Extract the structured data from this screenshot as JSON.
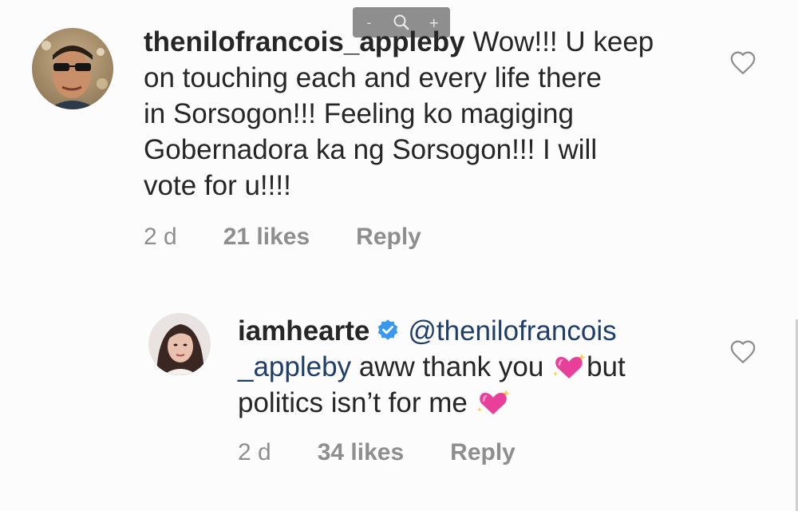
{
  "zoom_controls": {
    "zoom_out": "-",
    "zoom_in": "+"
  },
  "comments": [
    {
      "username": "thenilofrancois_appleby",
      "text_lines": [
        "Wow!!! U keep",
        "on touching each and every life there",
        "in Sorsogon!!! Feeling ko magiging",
        "Gobernadora ka ng Sorsogon!!! I will",
        "vote for u!!!!"
      ],
      "time": "2 d",
      "likes": "21 likes",
      "reply": "Reply"
    },
    {
      "username": "iamhearte",
      "verified": true,
      "mention_part1": "@thenilofrancois",
      "mention_part2": "_appleby",
      "text_after_mention": "aww thank you",
      "text_after_emoji": "but",
      "text_line3": "politics isn’t for me",
      "time": "2 d",
      "likes": "34 likes",
      "reply": "Reply"
    }
  ],
  "colors": {
    "username": "#262626",
    "meta": "#8e8e8e",
    "mention": "#1f3e6a",
    "verified": "#3897f0",
    "emoji_heart": "#e8409a"
  },
  "icons": [
    "magnifier-icon",
    "heart-outline-icon",
    "verified-badge-icon",
    "sparkling-heart-icon"
  ]
}
